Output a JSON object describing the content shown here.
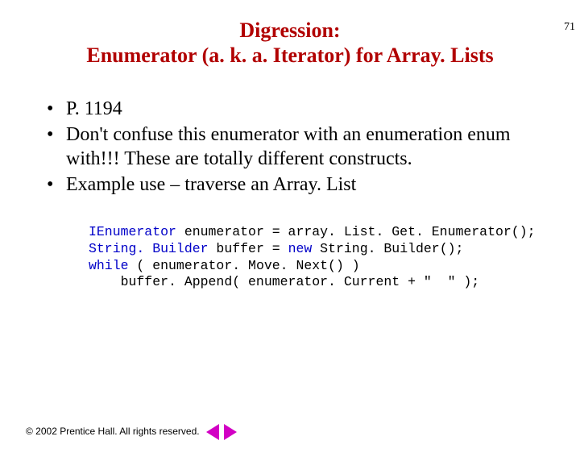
{
  "pageNumber": "71",
  "title": {
    "line1": "Digression:",
    "line2": "Enumerator (a. k. a. Iterator) for Array. Lists"
  },
  "bullets": [
    "P. 1194",
    "Don't confuse this enumerator with an enumeration enum with!!! These are totally different constructs.",
    "Example use – traverse an Array. List"
  ],
  "code": {
    "kw_IEnumerator": "IEnumerator",
    "line1_rest": " enumerator = array. List. Get. Enumerator();",
    "kw_StringBuilder": "String. Builder",
    "line2_mid": " buffer = ",
    "kw_new": "new",
    "line2_rest": " String. Builder();",
    "kw_while": "while",
    "line3_rest": " ( enumerator. Move. Next() )",
    "line4": "    buffer. Append( enumerator. Current + \"  \" );"
  },
  "footer": "© 2002 Prentice Hall. All rights reserved."
}
